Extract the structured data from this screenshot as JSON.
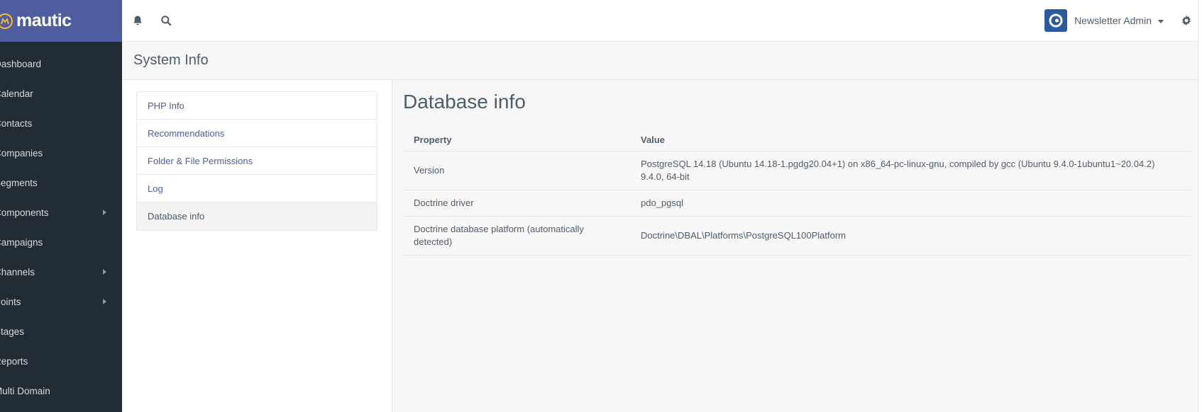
{
  "brand": {
    "name": "mautic"
  },
  "sidebar": {
    "items": [
      {
        "label": "Dashboard",
        "has_submenu": false
      },
      {
        "label": "Calendar",
        "has_submenu": false
      },
      {
        "label": "Contacts",
        "has_submenu": false
      },
      {
        "label": "Companies",
        "has_submenu": false
      },
      {
        "label": "Segments",
        "has_submenu": false
      },
      {
        "label": "Components",
        "has_submenu": true
      },
      {
        "label": "Campaigns",
        "has_submenu": false
      },
      {
        "label": "Channels",
        "has_submenu": true
      },
      {
        "label": "Points",
        "has_submenu": true
      },
      {
        "label": "Stages",
        "has_submenu": false
      },
      {
        "label": "Reports",
        "has_submenu": false
      },
      {
        "label": "Multi Domain",
        "has_submenu": false
      }
    ]
  },
  "topbar": {
    "user_name": "Newsletter Admin",
    "icons": [
      "bell-icon",
      "search-icon",
      "gear-icon"
    ]
  },
  "page": {
    "title": "System Info"
  },
  "tabs": {
    "items": [
      {
        "label": "PHP Info",
        "active": false
      },
      {
        "label": "Recommendations",
        "active": false
      },
      {
        "label": "Folder & File Permissions",
        "active": false
      },
      {
        "label": "Log",
        "active": false
      },
      {
        "label": "Database info",
        "active": true
      }
    ]
  },
  "content": {
    "title": "Database info",
    "table": {
      "headers": {
        "property": "Property",
        "value": "Value"
      },
      "rows": [
        {
          "property": "Version",
          "value": "PostgreSQL 14.18 (Ubuntu 14.18-1.pgdg20.04+1) on x86_64-pc-linux-gnu, compiled by gcc (Ubuntu 9.4.0-1ubuntu1~20.04.2) 9.4.0, 64-bit"
        },
        {
          "property": "Doctrine driver",
          "value": "pdo_pgsql"
        },
        {
          "property": "Doctrine database platform (automatically detected)",
          "value": "Doctrine\\DBAL\\Platforms\\PostgreSQL100Platform"
        }
      ]
    }
  },
  "colors": {
    "brand": "#4e5e9e",
    "sidebar": "#222c35",
    "accent_logo": "#fdb933",
    "link": "#4e5e9e"
  }
}
